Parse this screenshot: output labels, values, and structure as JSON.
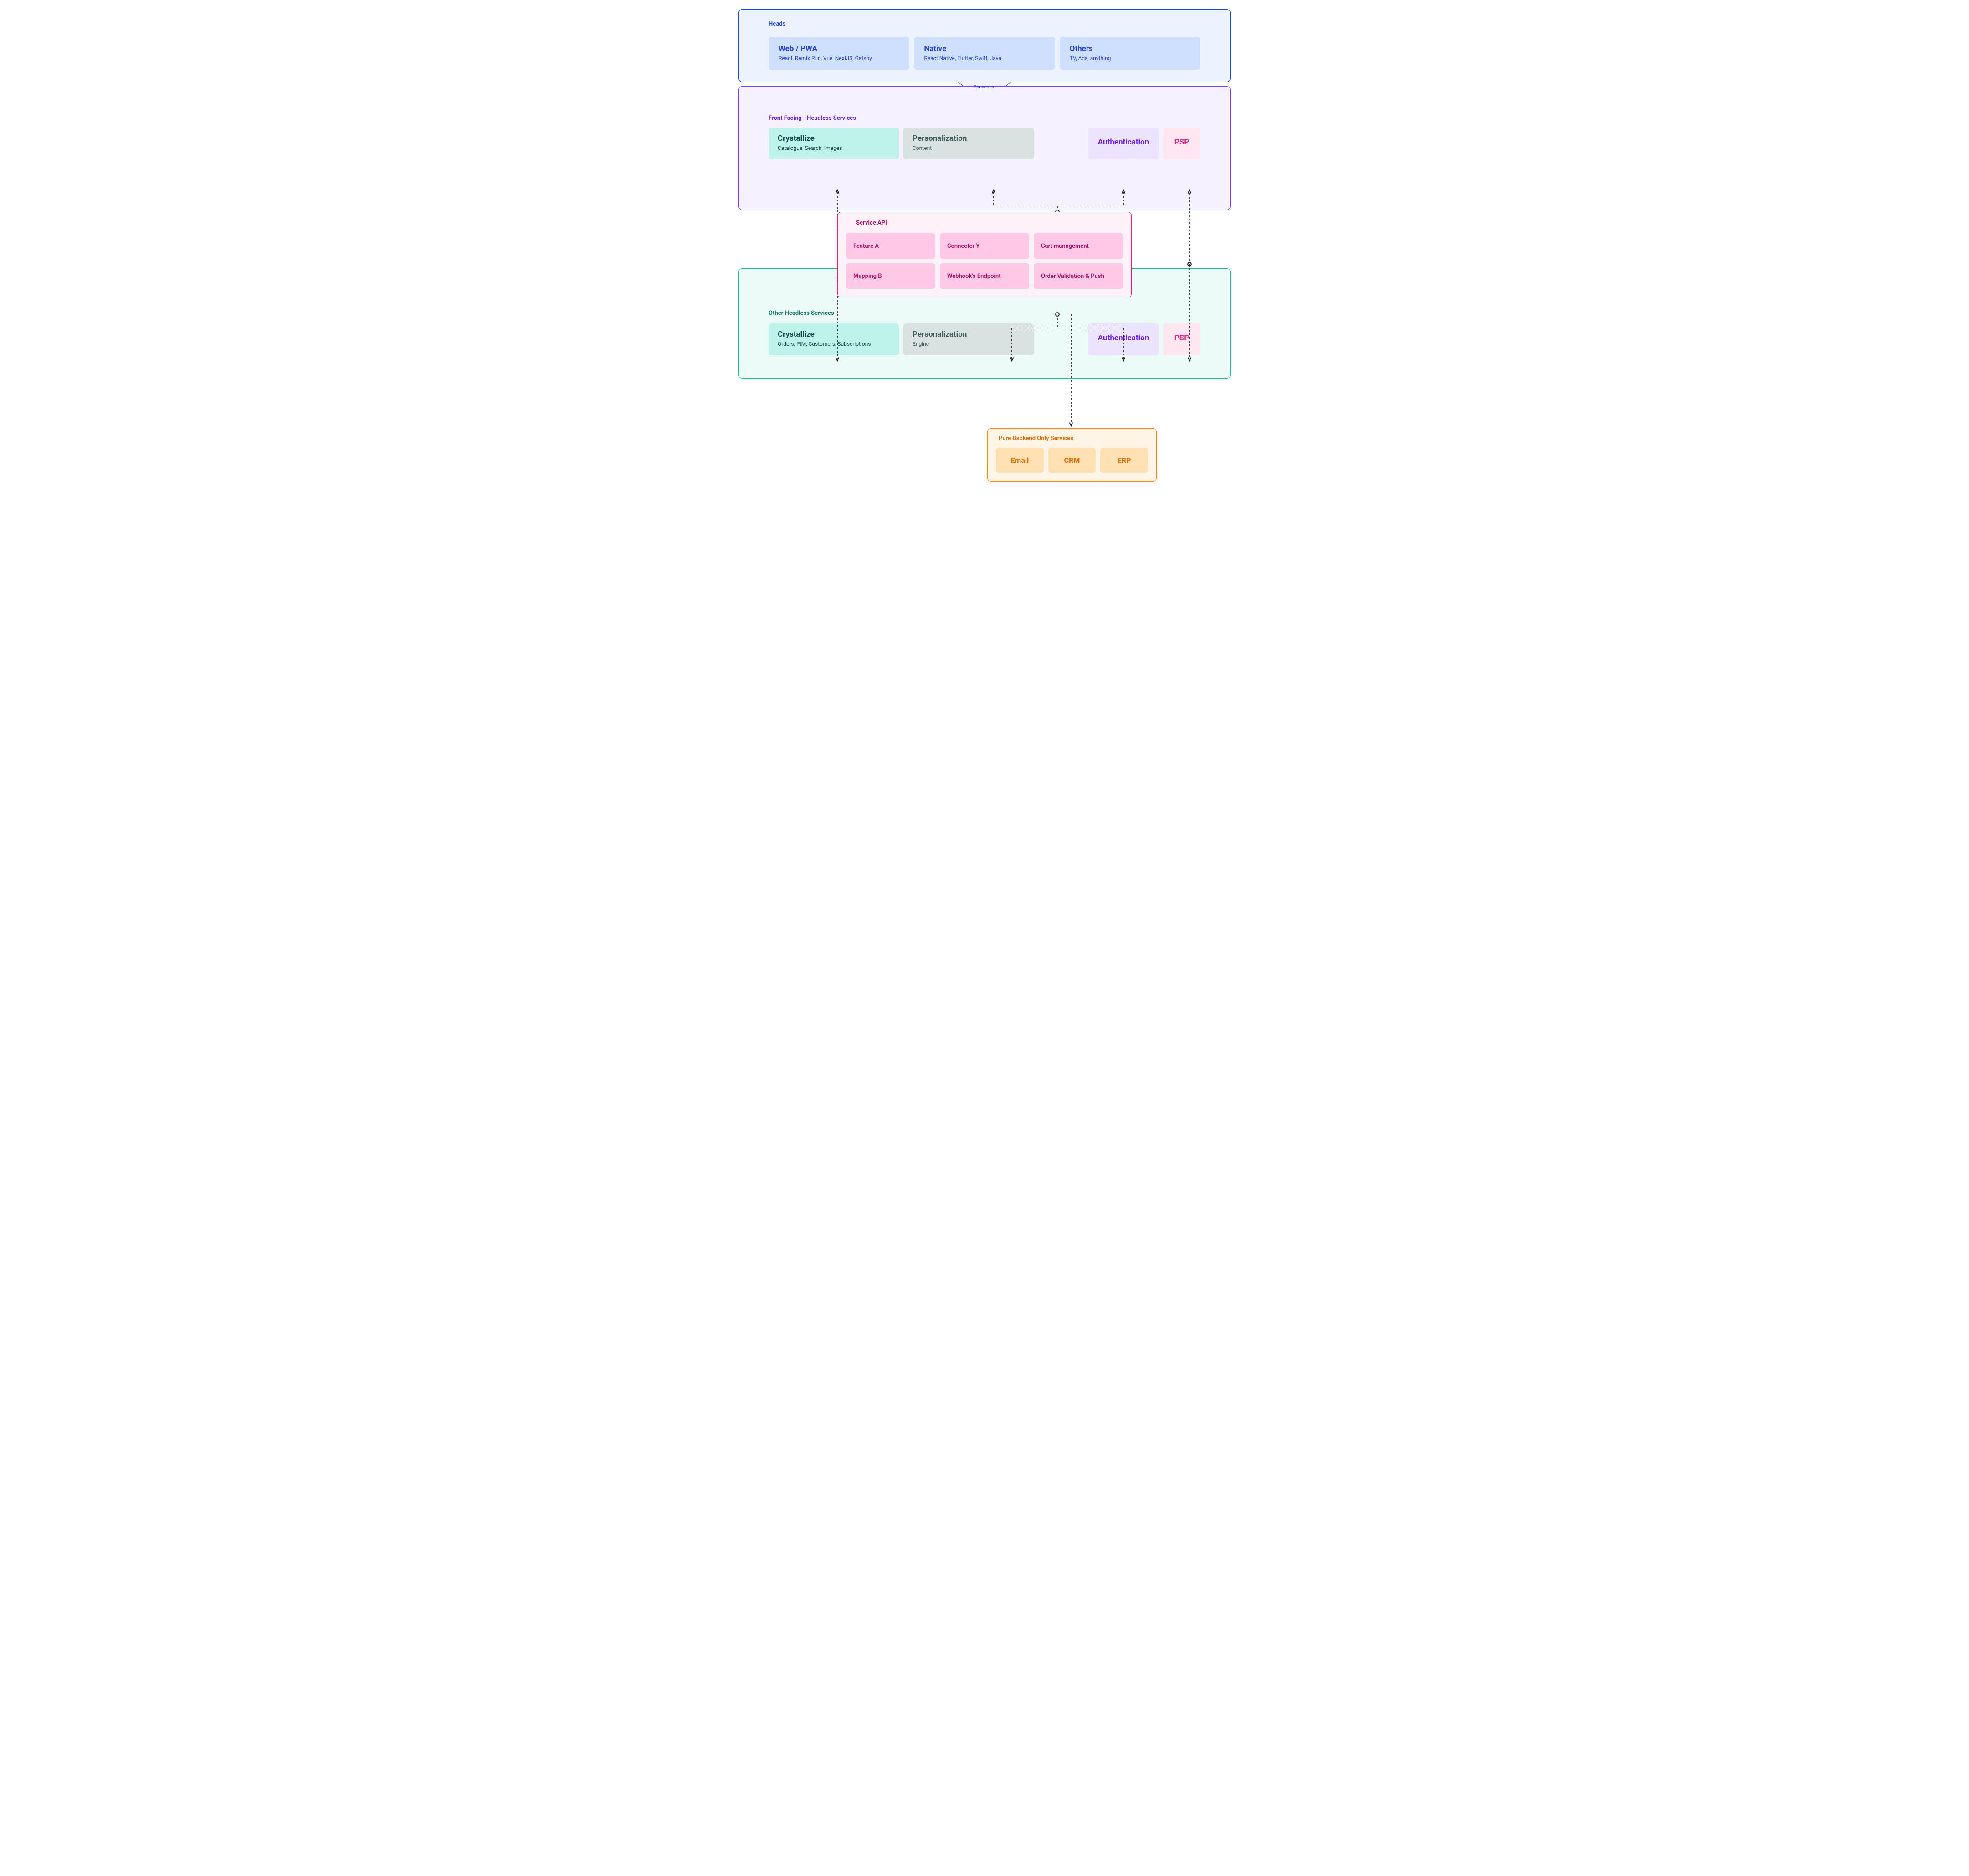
{
  "heads": {
    "title": "Heads",
    "cards": [
      {
        "title": "Web / PWA",
        "sub": "React, Remix Run, Vue, NextJS, Gatsby"
      },
      {
        "title": "Native",
        "sub": "React Native, Flutter, Swift, Java"
      },
      {
        "title": "Others",
        "sub": "TV, Ads, anything"
      }
    ]
  },
  "consumes_label": "Consumes",
  "front": {
    "title": "Front Facing - Headless Services",
    "crystallize": {
      "title": "Crystallize",
      "sub": "Catalogue, Search, Images"
    },
    "personalization": {
      "title": "Personalization",
      "sub": "Content"
    },
    "authentication": {
      "title": "Authentication"
    },
    "psp": {
      "title": "PSP"
    }
  },
  "service_api": {
    "title": "Service API",
    "cells": [
      "Feature A",
      "Connecter Y",
      "Cart management",
      "Mapping B",
      "Webhook's Endpoint",
      "Order Validation & Push"
    ]
  },
  "other": {
    "title": "Other Headless Services",
    "crystallize": {
      "title": "Crystallize",
      "sub": "Orders, PIM, Customers, Subscriptions"
    },
    "personalization": {
      "title": "Personalization",
      "sub": "Engine"
    },
    "authentication": {
      "title": "Authentication"
    },
    "psp": {
      "title": "PSP"
    }
  },
  "backend": {
    "title": "Pure Backend Only Services",
    "cells": [
      "Email",
      "CRM",
      "ERP"
    ]
  }
}
